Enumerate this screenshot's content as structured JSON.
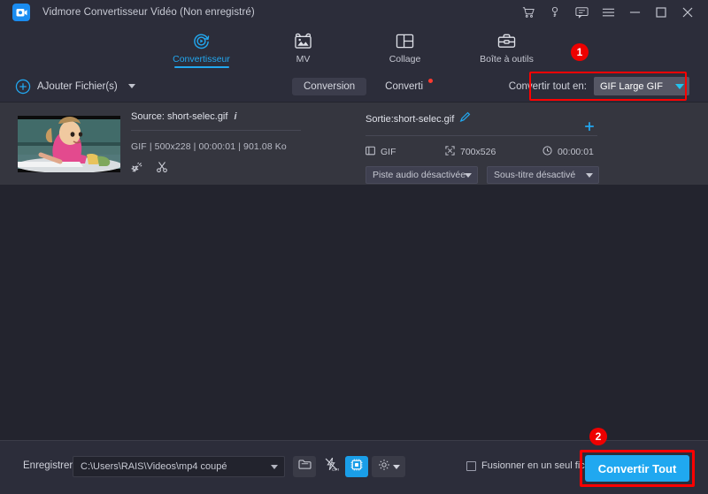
{
  "window": {
    "title": "Vidmore Convertisseur Vidéo (Non enregistré)",
    "logo_icon": "app-logo-icon",
    "controls": [
      {
        "name": "cart-icon",
        "label": "Panier"
      },
      {
        "name": "key-icon",
        "label": "Clé"
      },
      {
        "name": "chat-icon",
        "label": "Commentaires"
      },
      {
        "name": "menu-icon",
        "label": "Menu"
      },
      {
        "name": "minimize-icon",
        "label": "Réduire"
      },
      {
        "name": "maximize-icon",
        "label": "Agrandir"
      },
      {
        "name": "close-icon",
        "label": "Fermer"
      }
    ]
  },
  "nav": {
    "tabs": [
      {
        "label": "Convertisseur",
        "icon": "converter-icon",
        "active": true
      },
      {
        "label": "MV",
        "icon": "mv-icon",
        "active": false
      },
      {
        "label": "Collage",
        "icon": "collage-icon",
        "active": false
      },
      {
        "label": "Boîte à outils",
        "icon": "toolbox-icon",
        "active": false
      }
    ]
  },
  "toolbar": {
    "add_files_label": "AJouter Fichier(s)",
    "add_files_icon": "plus-circle-icon",
    "tabs": [
      {
        "label": "Conversion",
        "active": true,
        "badge": false
      },
      {
        "label": "Converti",
        "active": false,
        "badge": true
      }
    ],
    "convert_all_label": "Convertir tout en:",
    "convert_all_value": "GIF Large GIF",
    "highlight_badge": "1"
  },
  "file_row": {
    "thumbnail_name": "video-thumbnail",
    "source": {
      "label": "Source: short-selec.gif",
      "info_icon": "info-icon",
      "meta": "GIF | 500x228 | 00:00:01 | 901.08 Ko",
      "icons": [
        {
          "name": "edit-wand-icon"
        },
        {
          "name": "cut-scissors-icon"
        }
      ]
    },
    "arrow_icon": "right-arrow-icon",
    "output": {
      "label": "Sortie:short-selec.gif",
      "edit_icon": "pencil-edit-icon",
      "add_icon": "add-output-icon",
      "format": "GIF",
      "format_icon": "format-icon",
      "resolution": "700x526",
      "resolution_icon": "resize-icon",
      "duration": "00:00:01",
      "duration_icon": "clock-icon",
      "audio_track": "Piste audio désactivée",
      "subtitle": "Sous-titre désactivé"
    },
    "preview_icon": "preview-save-icon"
  },
  "bottom": {
    "save_label": "Enregistrer:",
    "save_path": "C:\\Users\\RAIS\\Videos\\mp4 coupé",
    "buttons": [
      {
        "name": "open-folder-icon"
      },
      {
        "name": "flash-off-icon"
      },
      {
        "name": "gpu-acceleration-icon"
      },
      {
        "name": "settings-gear-icon"
      }
    ],
    "merge_label": "Fusionner en un seul fichier",
    "convert_button": "Convertir Tout",
    "highlight_badge": "2"
  },
  "colors": {
    "accent": "#22a7ef",
    "convert_button": "#20a8f0",
    "highlight": "#ff0000",
    "badge": "#ee0000",
    "titlebar": "#2c2d3a",
    "body": "#23242e",
    "file_row": "#35363f"
  }
}
